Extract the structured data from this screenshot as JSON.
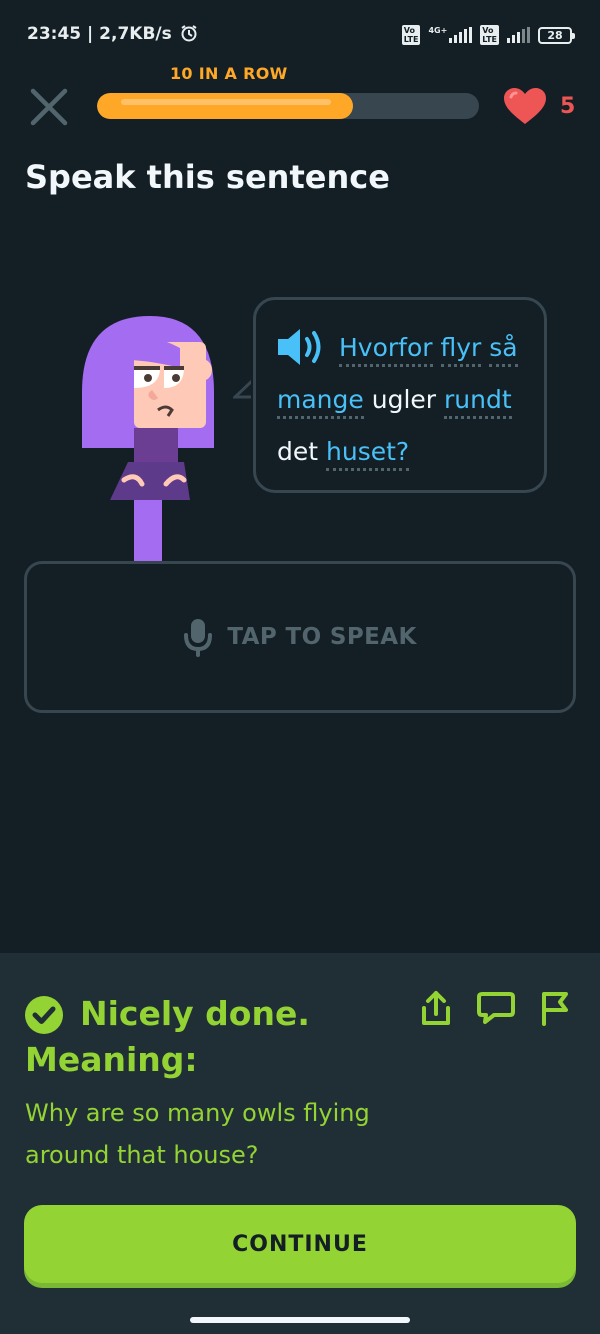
{
  "status_bar": {
    "time": "23:45",
    "speed": "2,7KB/s",
    "battery": "28",
    "network": "4G+",
    "sim_label": "Vo LTE"
  },
  "header": {
    "streak_label": "10 IN A ROW",
    "progress": 0.67,
    "hearts_count": "5"
  },
  "challenge": {
    "title": "Speak this sentence",
    "sentence_words": [
      {
        "text": "Hvorfor",
        "hint": true
      },
      {
        "text": "flyr",
        "hint": true
      },
      {
        "text": "så",
        "hint": true
      },
      {
        "text": "mange",
        "hint": true
      },
      {
        "text": "ugler",
        "hint": false
      },
      {
        "text": "rundt",
        "hint": true
      },
      {
        "text": "det",
        "hint": false
      },
      {
        "text": "huset?",
        "hint": true
      }
    ],
    "speak_button_label": "TAP TO SPEAK"
  },
  "feedback": {
    "headline": "Nicely done.",
    "meaning_label": "Meaning:",
    "translation": "Why are so many owls flying around that house?",
    "continue_label": "CONTINUE"
  },
  "icons": {
    "close": "close-icon",
    "heart": "heart-icon",
    "speaker": "speaker-icon",
    "mic": "microphone-icon",
    "check": "check-circle-icon",
    "share": "share-icon",
    "comment": "comment-icon",
    "report": "flag-icon"
  },
  "colors": {
    "background": "#131f24",
    "panel": "#202f36",
    "accent_orange": "#ffa827",
    "success_green": "#93d333",
    "hint_blue": "#49c0f8",
    "heart_red": "#ee5555",
    "border": "#37464f"
  }
}
